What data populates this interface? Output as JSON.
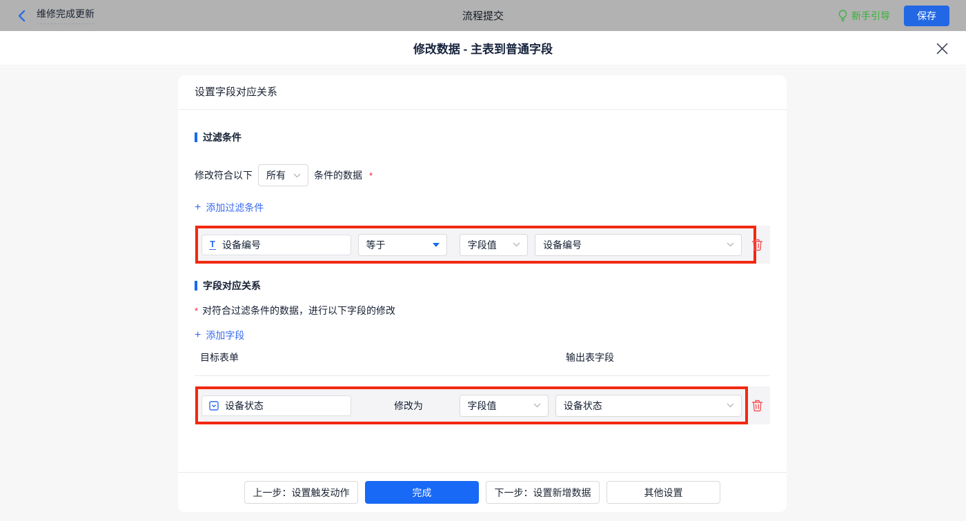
{
  "colors": {
    "accent_blue": "#1869f5",
    "link_blue": "#3a6bf2",
    "section_bar_blue": "#1669f5",
    "guide_green": "#36b037",
    "danger_red": "#f15557",
    "annotation_red": "#f2290f",
    "required_red": "#f5222d"
  },
  "topbar": {
    "back_icon": "chevron-left",
    "flow_title": "维修完成更新",
    "center_title": "流程提交",
    "guide_label": "新手引导",
    "save_label": "保存"
  },
  "modal": {
    "title": "修改数据 - 主表到普通字段",
    "close_icon": "close"
  },
  "panel": {
    "header": "设置字段对应关系",
    "filter_section": {
      "title": "过滤条件",
      "condition_prefix": "修改符合以下",
      "condition_select_value": "所有",
      "condition_suffix": "条件的数据",
      "required_mark": "*",
      "add_plus": "+",
      "add_label": "添加过滤条件",
      "row": {
        "field_icon": "text-field",
        "field": "设备编号",
        "operator": "等于",
        "value_type": "字段值",
        "value": "设备编号"
      }
    },
    "mapping_section": {
      "title": "字段对应关系",
      "required_mark": "*",
      "hint": "对符合过滤条件的数据，进行以下字段的修改",
      "add_plus": "+",
      "add_label": "添加字段",
      "col_target": "目标表单",
      "col_output": "输出表字段",
      "row": {
        "field_icon": "select-field",
        "field": "设备状态",
        "action": "修改为",
        "value_type": "字段值",
        "value": "设备状态"
      }
    },
    "footer": {
      "prev_label": "上一步：设置触发动作",
      "done_label": "完成",
      "next_label": "下一步：设置新增数据",
      "other_label": "其他设置"
    }
  }
}
